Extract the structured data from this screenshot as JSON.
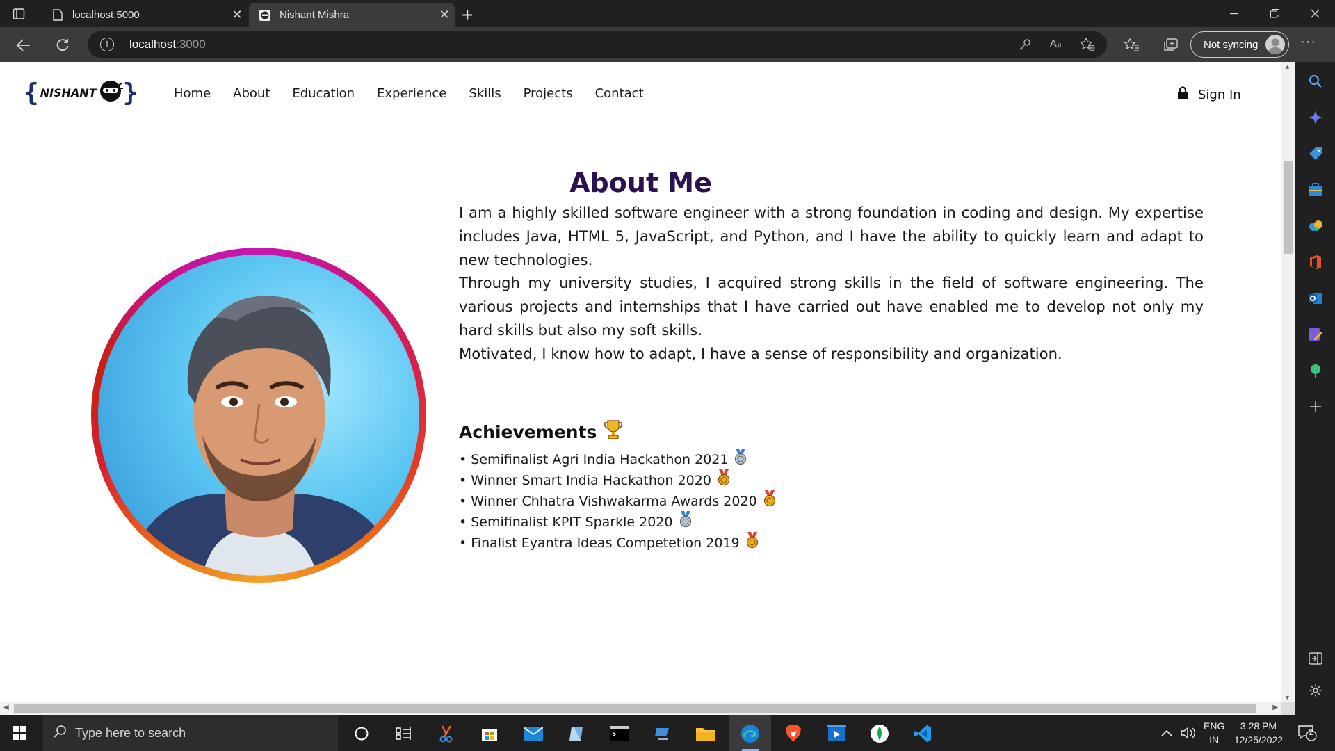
{
  "browser": {
    "tabs": [
      {
        "title": "localhost:5000",
        "active": false
      },
      {
        "title": "Nishant Mishra",
        "active": true
      }
    ],
    "address": {
      "host": "localhost",
      "port": ":3000"
    },
    "sync_label": "Not syncing"
  },
  "site": {
    "logo": {
      "left_brace": "{",
      "word": "NISHANT",
      "right_brace": "}"
    },
    "nav": [
      "Home",
      "About",
      "Education",
      "Experience",
      "Skills",
      "Projects",
      "Contact"
    ],
    "sign_in": "Sign In",
    "section_title": "About Me",
    "about_paragraphs": [
      "I am a highly skilled software engineer with a strong foundation in coding and design. My expertise includes Java, HTML 5, JavaScript, and Python, and I have the ability to quickly learn and adapt to new technologies.",
      "Through my university studies, I acquired strong skills in the field of software engineering. The various projects and internships that I have carried out have enabled me to develop not only my hard skills but also my soft skills.",
      "Motivated, I know how to adapt, I have a sense of responsibility and organization."
    ],
    "achievements_title": "Achievements",
    "achievements": [
      {
        "text": "• Semifinalist Agri India Hackathon 2021",
        "medal": "silver"
      },
      {
        "text": "• Winner Smart India Hackathon 2020",
        "medal": "gold"
      },
      {
        "text": "• Winner Chhatra Vishwakarma Awards 2020",
        "medal": "gold"
      },
      {
        "text": "• Semifinalist KPIT Sparkle 2020",
        "medal": "silver"
      },
      {
        "text": "• Finalist Eyantra Ideas Competetion 2019",
        "medal": "gold"
      }
    ]
  },
  "taskbar": {
    "search_placeholder": "Type here to search",
    "language": {
      "line1": "ENG",
      "line2": "IN"
    },
    "time": "3:28 PM",
    "date": "12/25/2022",
    "notification_count": "2"
  },
  "colors": {
    "heading": "#2b1150",
    "accent": "#1c2c6e",
    "gold_medal": "#f2b01e",
    "silver_medal": "#b9c3cc"
  }
}
